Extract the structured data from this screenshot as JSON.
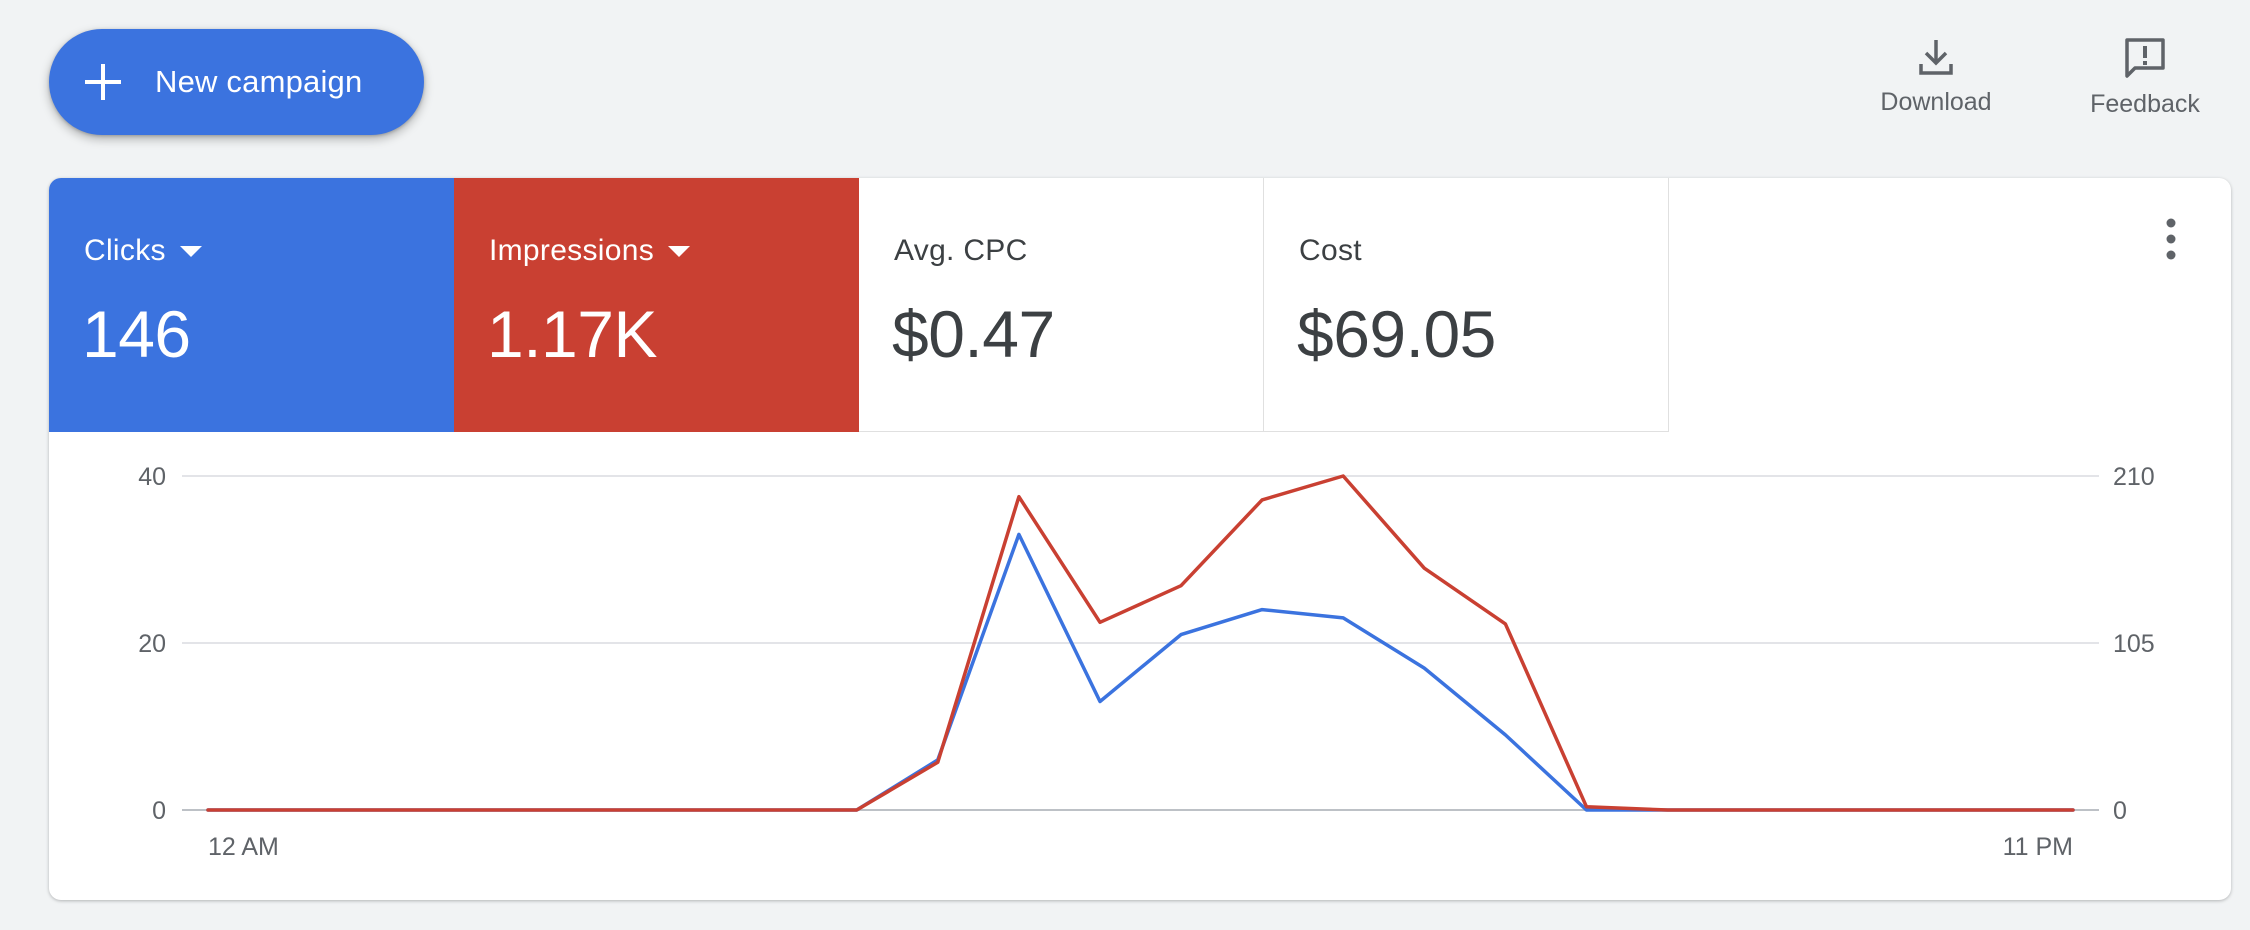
{
  "toolbar": {
    "new_campaign_label": "New campaign",
    "download_label": "Download",
    "feedback_label": "Feedback"
  },
  "metrics": [
    {
      "label": "Clicks",
      "value": "146",
      "selected": true,
      "color": "#3b73df"
    },
    {
      "label": "Impressions",
      "value": "1.17K",
      "selected": true,
      "color": "#c94032"
    },
    {
      "label": "Avg. CPC",
      "value": "$0.47",
      "selected": false
    },
    {
      "label": "Cost",
      "value": "$69.05",
      "selected": false
    }
  ],
  "icons": {
    "new_campaign": "plus-icon",
    "download": "download-icon",
    "feedback": "feedback-icon",
    "more": "more-vert-icon"
  },
  "chart_data": {
    "type": "line",
    "x_tick_labels": [
      "12 AM",
      "11 PM"
    ],
    "x": [
      0,
      1,
      2,
      3,
      4,
      5,
      6,
      7,
      8,
      9,
      10,
      11,
      12,
      13,
      14,
      15,
      16,
      17,
      18,
      19,
      20,
      21,
      22,
      23
    ],
    "y_left_ticks": [
      "0",
      "20",
      "40"
    ],
    "y_right_ticks": [
      "0",
      "105",
      "210"
    ],
    "ylim_left": [
      0,
      40
    ],
    "ylim_right": [
      0,
      210
    ],
    "grid": true,
    "series": [
      {
        "name": "Clicks",
        "axis": "left",
        "color": "#3b73df",
        "values": [
          0,
          0,
          0,
          0,
          0,
          0,
          0,
          0,
          0,
          6,
          33,
          13,
          21,
          24,
          23,
          17,
          9,
          0,
          0,
          0,
          0,
          0,
          0,
          0
        ]
      },
      {
        "name": "Impressions",
        "axis": "right",
        "color": "#c94032",
        "values": [
          0,
          0,
          0,
          0,
          0,
          0,
          0,
          0,
          0,
          30,
          197,
          118,
          141,
          195,
          210,
          152,
          117,
          2,
          0,
          0,
          0,
          0,
          0,
          0
        ]
      }
    ]
  }
}
